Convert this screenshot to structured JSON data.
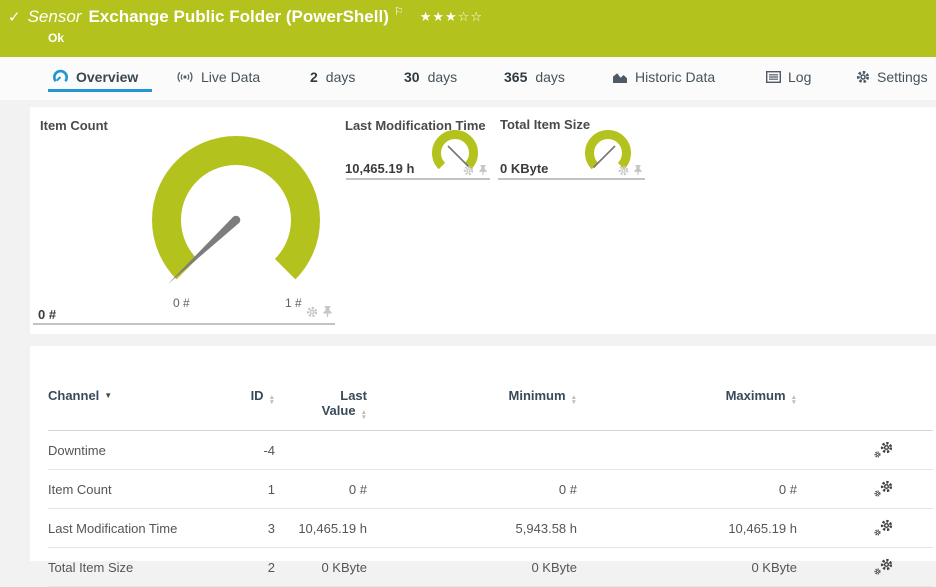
{
  "header": {
    "sensor_label": "Sensor",
    "title": "Exchange Public Folder (PowerShell)",
    "status": "Ok",
    "rating": {
      "filled": "★★★",
      "empty": "☆☆"
    }
  },
  "icons": {
    "check": "✓",
    "flag": "⚐",
    "sort_desc": "▼",
    "sort_up": "▲",
    "sort_down": "▼"
  },
  "tabs": [
    {
      "pre": "",
      "label": "Overview"
    },
    {
      "pre": "",
      "label": "Live Data"
    },
    {
      "pre": "2",
      "label": "days"
    },
    {
      "pre": "30",
      "label": "days"
    },
    {
      "pre": "365",
      "label": "days"
    },
    {
      "pre": "",
      "label": "Historic Data"
    },
    {
      "pre": "",
      "label": "Log"
    },
    {
      "pre": "",
      "label": "Settings"
    }
  ],
  "gauges": {
    "item_count": {
      "title": "Item Count",
      "value": "0 #",
      "scale_min": "0 #",
      "scale_max": "1 #"
    },
    "last_modification_time": {
      "title": "Last Modification Time",
      "value": "10,465.19 h"
    },
    "total_item_size": {
      "title": "Total Item Size",
      "value": "0 KByte"
    }
  },
  "table": {
    "cols": {
      "channel": "Channel",
      "id": "ID",
      "last1": "Last",
      "last2": "Value",
      "min": "Minimum",
      "max": "Maximum"
    },
    "rows": [
      {
        "channel": "Downtime",
        "id": "-4",
        "last": "",
        "min": "",
        "max": ""
      },
      {
        "channel": "Item Count",
        "id": "1",
        "last": "0 #",
        "min": "0 #",
        "max": "0 #"
      },
      {
        "channel": "Last Modification Time",
        "id": "3",
        "last": "10,465.19 h",
        "min": "5,943.58 h",
        "max": "10,465.19 h"
      },
      {
        "channel": "Total Item Size",
        "id": "2",
        "last": "0 KByte",
        "min": "0 KByte",
        "max": "0 KByte"
      }
    ]
  },
  "colors": {
    "ok_green": "#b4c21d",
    "accent_blue": "#2097d4"
  },
  "chart_data": [
    {
      "type": "gauge",
      "title": "Item Count",
      "value": 0,
      "unit": "#",
      "min": 0,
      "max": 1
    },
    {
      "type": "gauge",
      "title": "Last Modification Time",
      "value": 10465.19,
      "unit": "h"
    },
    {
      "type": "gauge",
      "title": "Total Item Size",
      "value": 0,
      "unit": "KByte"
    }
  ]
}
